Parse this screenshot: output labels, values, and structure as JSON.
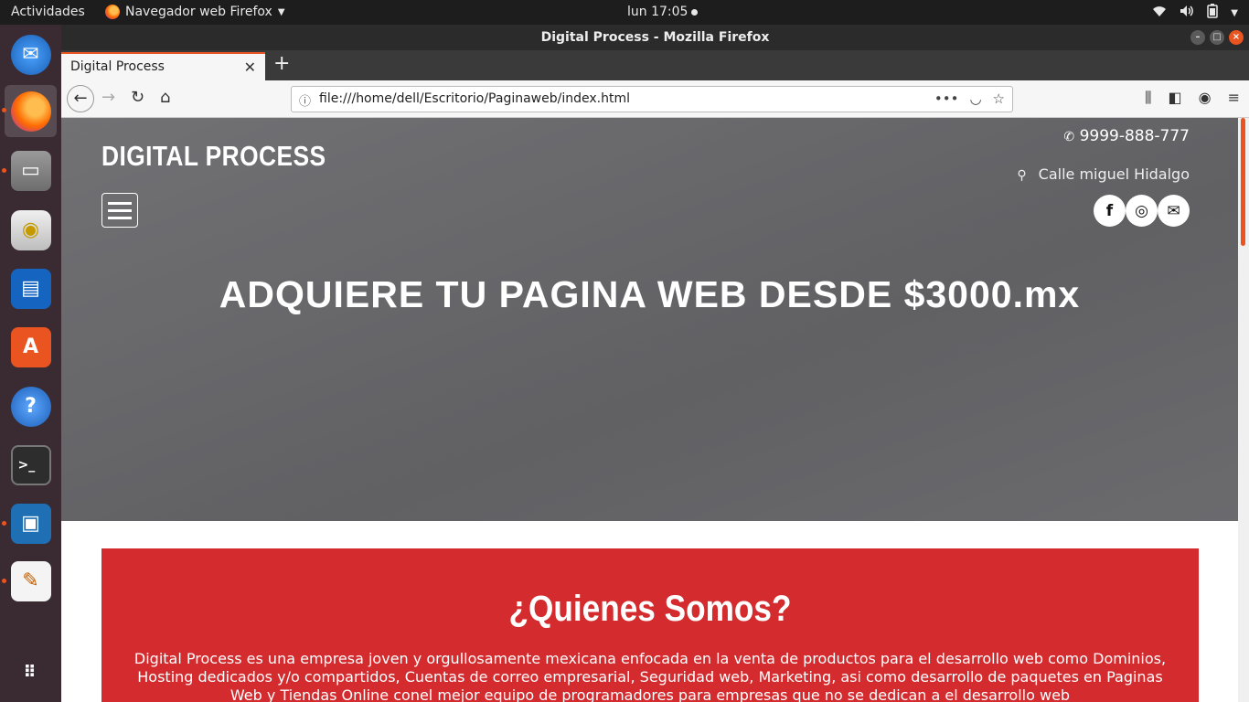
{
  "topbar": {
    "activities": "Actividades",
    "app_name": "Navegador web Firefox",
    "clock": "lun 17:05"
  },
  "dock": {
    "items": [
      "Thunderbird",
      "Firefox",
      "Archivos",
      "Rhythmbox",
      "LibreOffice Writer",
      "Ubuntu Software",
      "Ayuda",
      "Terminal",
      "Screen Recorder",
      "Editor de texto",
      "Mostrar aplicaciones"
    ]
  },
  "window": {
    "title": "Digital Process - Mozilla Firefox",
    "tab_title": "Digital Process",
    "url": "file:///home/dell/Escritorio/Paginaweb/index.html"
  },
  "site": {
    "brand": "DIGITAL PROCESS",
    "phone": "9999-888-777",
    "address": "Calle miguel Hidalgo",
    "headline": "ADQUIERE TU PAGINA WEB DESDE $3000.mx",
    "about_title": "¿Quienes Somos?",
    "about_text": "Digital Process es una empresa joven y orgullosamente mexicana enfocada en la venta de productos para el desarrollo web como Dominios, Hosting dedicados y/o compartidos, Cuentas de correo empresarial, Seguridad web, Marketing, asi como desarrollo de paquetes en Paginas Web y Tiendas Online conel mejor equipo de programadores para empresas que no se dedican a el desarrollo web"
  },
  "colors": {
    "accent": "#e95420",
    "about_bg": "#d32b2e"
  }
}
